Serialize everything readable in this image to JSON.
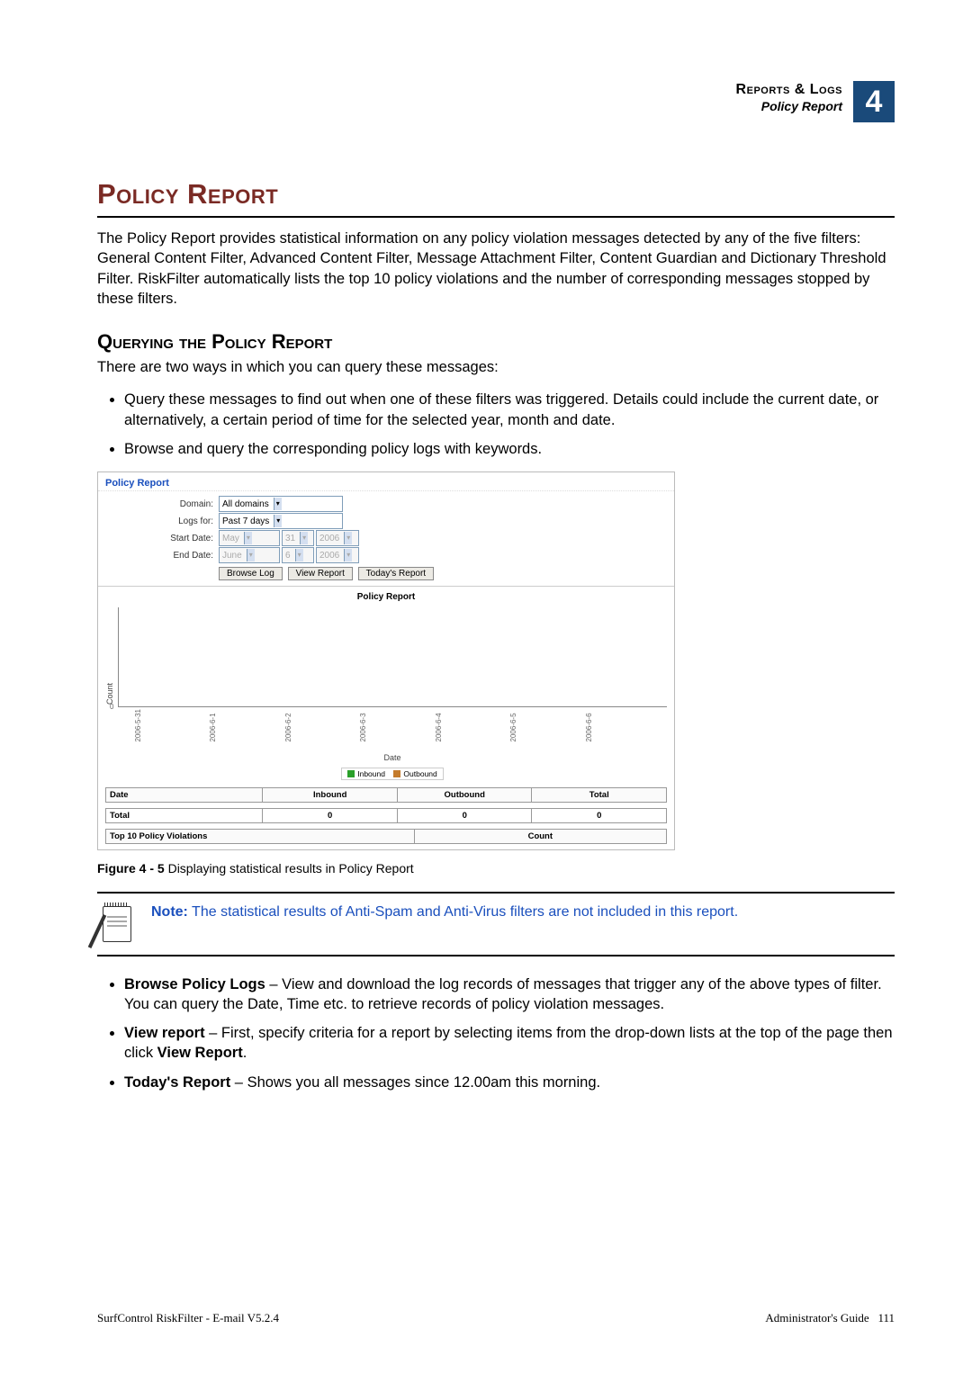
{
  "header": {
    "chapter": "Reports & Logs",
    "subtitle": "Policy Report",
    "chapter_number": "4"
  },
  "h1": "Policy Report",
  "intro": "The Policy Report provides statistical information on any policy violation messages detected by any of the five filters: General Content Filter, Advanced Content Filter, Message Attachment Filter, Content Guardian and Dictionary Threshold Filter. RiskFilter automatically lists the top 10 policy violations and the number of corresponding messages stopped by these filters.",
  "h2": "Querying the Policy Report",
  "query_intro": "There are two ways in which you can query these messages:",
  "query_bullets": [
    "Query these messages to find out when one of these filters was triggered. Details could include the current date, or alternatively, a certain period of time for the selected year, month and date.",
    "Browse and query the corresponding policy logs with keywords."
  ],
  "fig": {
    "panel_title": "Policy Report",
    "form": {
      "domain_label": "Domain:",
      "domain_value": "All domains",
      "logsfor_label": "Logs for:",
      "logsfor_value": "Past 7 days",
      "start_label": "Start Date:",
      "start_month": "May",
      "start_day": "31",
      "start_year": "2006",
      "end_label": "End Date:",
      "end_month": "June",
      "end_day": "6",
      "end_year": "2006",
      "btn_browse": "Browse Log",
      "btn_view": "View Report",
      "btn_today": "Today's Report"
    },
    "chart_title": "Policy Report",
    "y_axis": "Count",
    "y_zero": "0",
    "x_axis": "Date",
    "legend_in": "Inbound",
    "legend_out": "Outbound",
    "results": {
      "h_date": "Date",
      "h_in": "Inbound",
      "h_out": "Outbound",
      "h_total": "Total",
      "row_label": "Total",
      "v_in": "0",
      "v_out": "0",
      "v_total": "0"
    },
    "top10": {
      "h_violations": "Top 10 Policy Violations",
      "h_count": "Count"
    }
  },
  "chart_data": {
    "type": "bar",
    "categories": [
      "2006-5-31",
      "2006-6-1",
      "2006-6-2",
      "2006-6-3",
      "2006-6-4",
      "2006-6-5",
      "2006-6-6"
    ],
    "series": [
      {
        "name": "Inbound",
        "values": [
          0,
          0,
          0,
          0,
          0,
          0,
          0
        ]
      },
      {
        "name": "Outbound",
        "values": [
          0,
          0,
          0,
          0,
          0,
          0,
          0
        ]
      }
    ],
    "title": "Policy Report",
    "xlabel": "Date",
    "ylabel": "Count",
    "ylim": [
      0,
      1
    ]
  },
  "fig_caption_bold": "Figure 4 - 5",
  "fig_caption_rest": " Displaying statistical results in Policy Report",
  "note": {
    "label": "Note:",
    "text": "  The statistical results of Anti-Spam and Anti-Virus filters are not included in this report."
  },
  "actions": {
    "b1_bold": "Browse Policy Logs",
    "b1_rest": " – View and download the log records of messages that trigger any of the above types of filter. You can query the Date, Time etc. to retrieve records of policy violation messages.",
    "b2_bold": "View report",
    "b2_mid": " – First, specify criteria for a report by selecting items from the drop-down lists at the top of the page then click ",
    "b2_bold2": "View Report",
    "b2_end": ".",
    "b3_bold": "Today's Report",
    "b3_rest": " – Shows you all messages since 12.00am this morning."
  },
  "footer": {
    "left": "SurfControl RiskFilter - E-mail V5.2.4",
    "right_label": "Administrator's Guide",
    "right_page": "111"
  }
}
